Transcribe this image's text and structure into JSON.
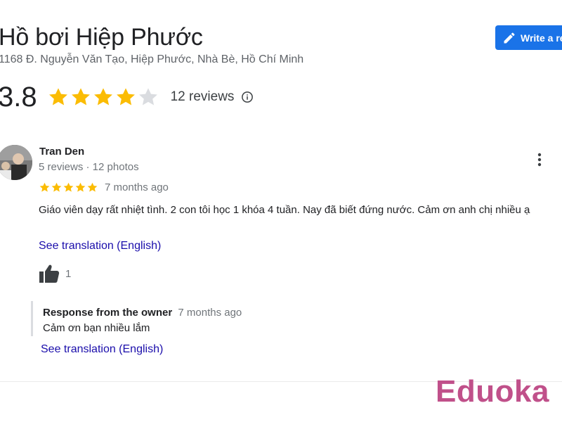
{
  "place": {
    "name": "Hồ bơi Hiệp Phước",
    "address": "1168 Đ. Nguyễn Văn Tạo, Hiệp Phước, Nhà Bè, Hồ Chí Minh"
  },
  "header": {
    "write_review_label": "Write a review",
    "write_review_icon": "pencil-icon"
  },
  "rating": {
    "value": "3.8",
    "stars_filled": 4,
    "stars_total": 5,
    "reviews_label": "12 reviews",
    "info_icon": "info-icon"
  },
  "review": {
    "author": "Tran Den",
    "author_meta": "5 reviews · 12 photos",
    "stars": 5,
    "time": "7 months ago",
    "text": "Giáo viên dạy rất nhiệt tình. 2 con tôi học 1 khóa 4 tuần. Nay đã biết đứng nước. Cảm ơn anh chị nhiều ạ",
    "translation_link": "See translation (English)",
    "likes": "1",
    "like_icon": "thumbs-up-icon",
    "more_icon": "more-vertical-icon"
  },
  "owner_response": {
    "label": "Response from the owner",
    "time": "7 months ago",
    "text": "Cảm ơn bạn nhiều lắm",
    "translation_link": "See translation (English)"
  },
  "watermark": {
    "text": "Eduoka"
  },
  "colors": {
    "star": "#fbbc04",
    "star_empty": "#dadce0",
    "accent": "#1a73e8",
    "link": "#1a0dab",
    "watermark": "#c0508a"
  }
}
